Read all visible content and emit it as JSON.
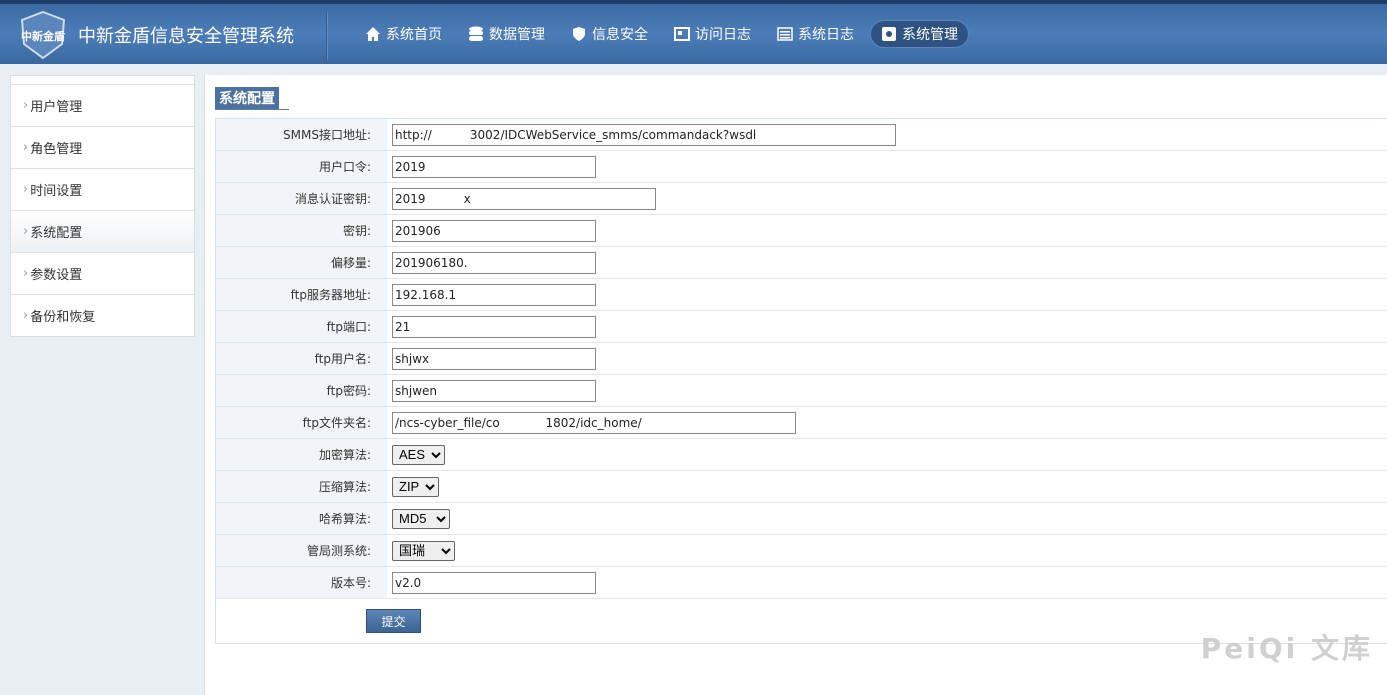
{
  "header": {
    "logo_text": "中新金盾",
    "title": "中新金盾信息安全管理系统",
    "nav": [
      {
        "label": "系统首页",
        "icon": "home-icon"
      },
      {
        "label": "数据管理",
        "icon": "database-icon"
      },
      {
        "label": "信息安全",
        "icon": "shield-icon"
      },
      {
        "label": "访问日志",
        "icon": "log-icon"
      },
      {
        "label": "系统日志",
        "icon": "list-icon"
      },
      {
        "label": "系统管理",
        "icon": "gear-icon"
      }
    ]
  },
  "sidebar": {
    "items": [
      {
        "label": "用户管理"
      },
      {
        "label": "角色管理"
      },
      {
        "label": "时间设置"
      },
      {
        "label": "系统配置"
      },
      {
        "label": "参数设置"
      },
      {
        "label": "备份和恢复"
      }
    ]
  },
  "main": {
    "title": "系统配置",
    "fields": [
      {
        "label": "SMMS接口地址:",
        "value": "http://          3002/IDCWebService_smms/commandack?wsdl"
      },
      {
        "label": "用户口令:",
        "value": "2019"
      },
      {
        "label": "消息认证密钥:",
        "value": "2019          x"
      },
      {
        "label": "密钥:",
        "value": "201906"
      },
      {
        "label": "偏移量:",
        "value": "201906180."
      },
      {
        "label": "ftp服务器地址:",
        "value": "192.168.1"
      },
      {
        "label": "ftp端口:",
        "value": "21"
      },
      {
        "label": "ftp用户名:",
        "value": "shjwx"
      },
      {
        "label": "ftp密码:",
        "value": "shjwen"
      },
      {
        "label": "ftp文件夹名:",
        "value": "/ncs-cyber_file/co            1802/idc_home/"
      },
      {
        "label": "加密算法:",
        "value": "AES"
      },
      {
        "label": "压缩算法:",
        "value": "ZIP"
      },
      {
        "label": "哈希算法:",
        "value": "MD5"
      },
      {
        "label": "管局测系统:",
        "value": "国瑞"
      },
      {
        "label": "版本号:",
        "value": "v2.0"
      }
    ],
    "submit_label": "提交"
  },
  "watermark": "PeiQi 文库"
}
